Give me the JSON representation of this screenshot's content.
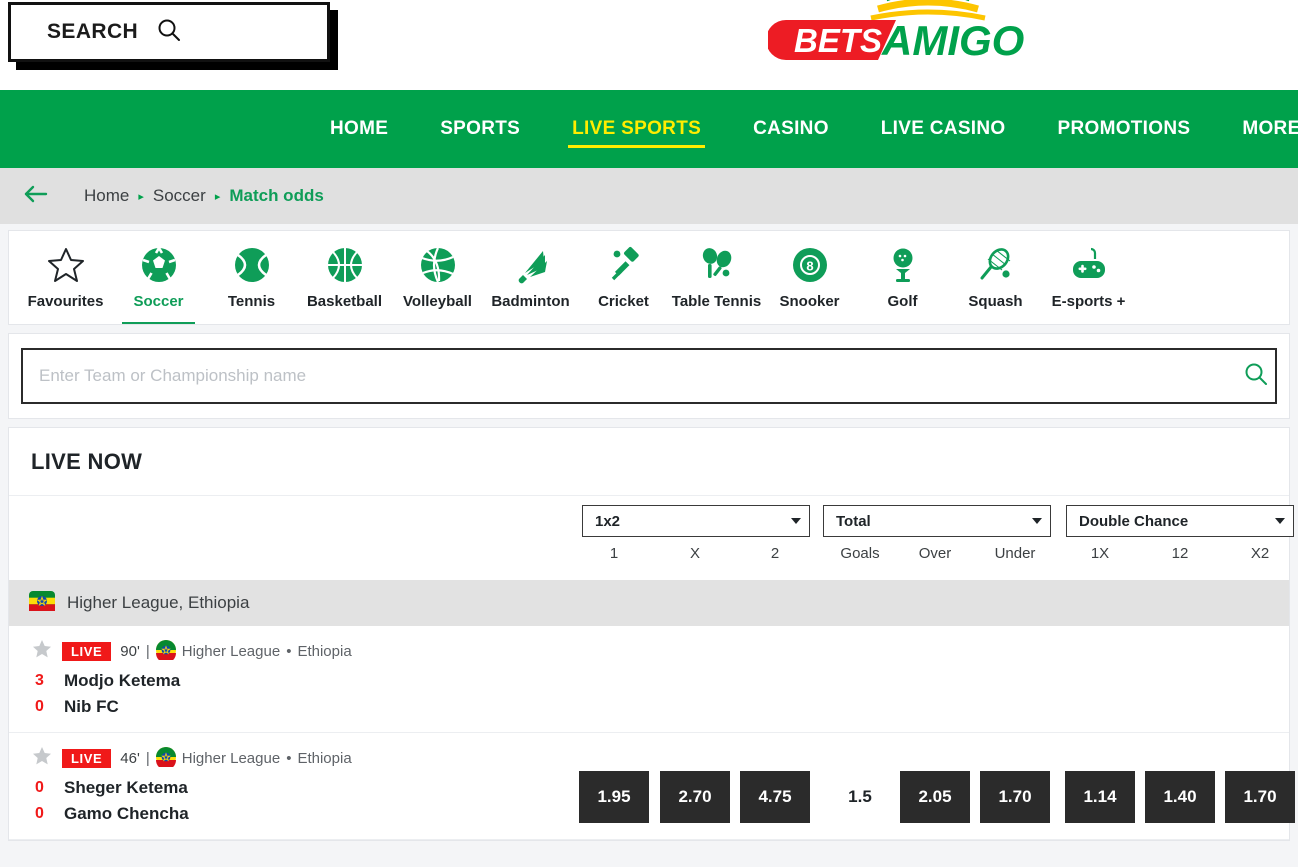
{
  "header": {
    "search_button_label": "SEARCH",
    "search_icon": "search-icon",
    "logo": {
      "part1": "BETS",
      "part2": "AMIGO"
    }
  },
  "nav": {
    "items": [
      {
        "label": "HOME",
        "active": false
      },
      {
        "label": "SPORTS",
        "active": false
      },
      {
        "label": "LIVE SPORTS",
        "active": true
      },
      {
        "label": "CASINO",
        "active": false
      },
      {
        "label": "LIVE CASINO",
        "active": false
      },
      {
        "label": "PROMOTIONS",
        "active": false
      },
      {
        "label": "MORE",
        "active": false
      }
    ]
  },
  "breadcrumb": {
    "back_icon": "arrow-left-icon",
    "items": [
      {
        "label": "Home",
        "current": false
      },
      {
        "label": "Soccer",
        "current": false
      },
      {
        "label": "Match odds",
        "current": true
      }
    ],
    "separator": "▸"
  },
  "sports": [
    {
      "label": "Favourites",
      "icon": "star-outline-icon",
      "active": false
    },
    {
      "label": "Soccer",
      "icon": "soccer-ball-icon",
      "active": true
    },
    {
      "label": "Tennis",
      "icon": "tennis-ball-icon",
      "active": false
    },
    {
      "label": "Basketball",
      "icon": "basketball-icon",
      "active": false
    },
    {
      "label": "Volleyball",
      "icon": "volleyball-icon",
      "active": false
    },
    {
      "label": "Badminton",
      "icon": "shuttlecock-icon",
      "active": false
    },
    {
      "label": "Cricket",
      "icon": "cricket-bat-icon",
      "active": false
    },
    {
      "label": "Table Tennis",
      "icon": "table-tennis-paddle-icon",
      "active": false
    },
    {
      "label": "Snooker",
      "icon": "eight-ball-icon",
      "active": false
    },
    {
      "label": "Golf",
      "icon": "golf-ball-tee-icon",
      "active": false
    },
    {
      "label": "Squash",
      "icon": "squash-racket-icon",
      "active": false
    },
    {
      "label": "E-sports +",
      "icon": "gamepad-icon",
      "active": false
    }
  ],
  "team_search": {
    "placeholder": "Enter Team or Championship name",
    "value": "",
    "icon": "search-icon"
  },
  "live_now": {
    "title": "LIVE NOW",
    "markets": [
      {
        "name": "1x2",
        "columns": [
          "1",
          "X",
          "2"
        ]
      },
      {
        "name": "Total",
        "columns": [
          "Goals",
          "Over",
          "Under"
        ]
      },
      {
        "name": "Double Chance",
        "columns": [
          "1X",
          "12",
          "X2"
        ]
      }
    ],
    "league_header": {
      "name": "Higher League, Ethiopia",
      "flag": "ethiopia-flag-icon"
    },
    "matches": [
      {
        "favourite_icon": "star-filled-icon",
        "status": "LIVE",
        "minute": "90'",
        "league": "Higher League",
        "country": "Ethiopia",
        "flag": "ethiopia-flag-icon",
        "home_team": "Modjo Ketema",
        "away_team": "Nib FC",
        "home_score": "3",
        "away_score": "0",
        "odds": []
      },
      {
        "favourite_icon": "star-filled-icon",
        "status": "LIVE",
        "minute": "46'",
        "league": "Higher League",
        "country": "Ethiopia",
        "flag": "ethiopia-flag-icon",
        "home_team": "Sheger Ketema",
        "away_team": "Gamo Chencha",
        "home_score": "0",
        "away_score": "0",
        "odds": [
          {
            "value": "1.95",
            "plain": false
          },
          {
            "value": "2.70",
            "plain": false
          },
          {
            "value": "4.75",
            "plain": false
          },
          {
            "value": "1.5",
            "plain": true
          },
          {
            "value": "2.05",
            "plain": false
          },
          {
            "value": "1.70",
            "plain": false
          },
          {
            "value": "1.14",
            "plain": false
          },
          {
            "value": "1.40",
            "plain": false
          },
          {
            "value": "1.70",
            "plain": false
          }
        ]
      }
    ]
  },
  "colors": {
    "brand_green": "#00a14b",
    "accent_yellow": "#ffed00",
    "logo_red": "#ed1c24",
    "live_red": "#f01919",
    "odds_bg": "#2b2b2b"
  }
}
